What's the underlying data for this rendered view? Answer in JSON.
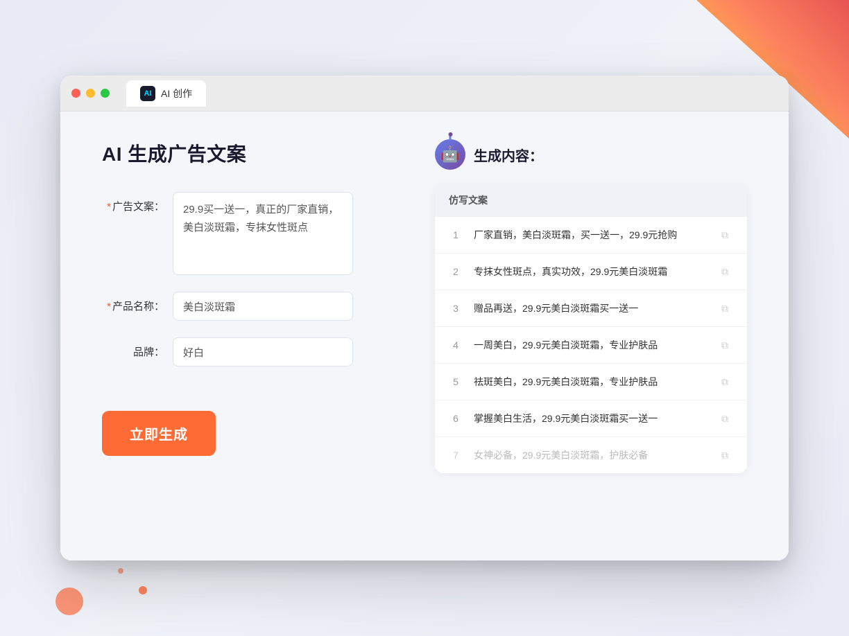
{
  "window": {
    "tab_label": "AI 创作"
  },
  "page": {
    "title": "AI 生成广告文案"
  },
  "form": {
    "ad_copy_label": "广告文案：",
    "ad_copy_required": "*",
    "ad_copy_value": "29.9买一送一，真正的厂家直销，美白淡斑霜，专抹女性斑点",
    "product_name_label": "产品名称：",
    "product_name_required": "*",
    "product_name_value": "美白淡斑霜",
    "brand_label": "品牌：",
    "brand_value": "好白",
    "generate_button": "立即生成"
  },
  "result": {
    "header_title": "生成内容：",
    "column_header": "仿写文案",
    "items": [
      {
        "num": "1",
        "text": "厂家直销，美白淡斑霜，买一送一，29.9元抢购",
        "muted": false
      },
      {
        "num": "2",
        "text": "专抹女性斑点，真实功效，29.9元美白淡斑霜",
        "muted": false
      },
      {
        "num": "3",
        "text": "赠品再送，29.9元美白淡斑霜买一送一",
        "muted": false
      },
      {
        "num": "4",
        "text": "一周美白，29.9元美白淡斑霜，专业护肤品",
        "muted": false
      },
      {
        "num": "5",
        "text": "祛斑美白，29.9元美白淡斑霜，专业护肤品",
        "muted": false
      },
      {
        "num": "6",
        "text": "掌握美白生活，29.9元美白淡斑霜买一送一",
        "muted": false
      },
      {
        "num": "7",
        "text": "女神必备，29.9元美白淡斑霜，护肤必备",
        "muted": true
      }
    ]
  },
  "icons": {
    "ai_icon": "AI",
    "robot_emoji": "🤖",
    "copy_symbol": "⧉"
  }
}
